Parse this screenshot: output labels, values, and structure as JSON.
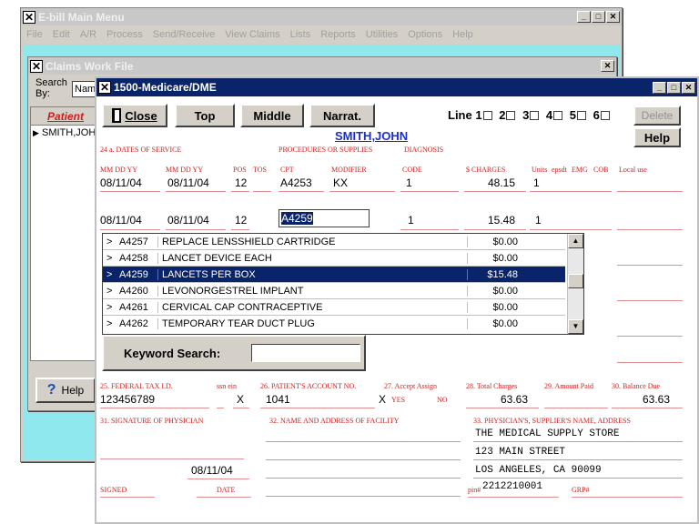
{
  "main_window": {
    "title": "E-bill Main Menu",
    "menu": [
      "File",
      "Edit",
      "A/R",
      "Process",
      "Send/Receive",
      "View Claims",
      "Lists",
      "Reports",
      "Utilities",
      "Options",
      "Help"
    ]
  },
  "claims_window": {
    "title": "Claims Work File",
    "search_label": "Search By:",
    "search_value": "Nam",
    "patient_header": "Patient",
    "patient_row": "SMITH,JOH",
    "help_button": "Help"
  },
  "form_window": {
    "title": "1500-Medicare/DME",
    "buttons": {
      "close": "Close",
      "top": "Top",
      "middle": "Middle",
      "narrat": "Narrat.",
      "delete": "Delete",
      "help": "Help"
    },
    "line_label": "Line 1",
    "line_numbers": [
      "2",
      "3",
      "4",
      "5",
      "6"
    ],
    "patient_name": "SMITH,JOHN",
    "labels": {
      "dates_of_service": "24 a. DATES OF SERVICE",
      "procedures": "PROCEDURES OR SUPPLIES",
      "diagnosis": "DIAGNOSIS",
      "from_date": "MM DD YY",
      "to_date": "MM DD YY",
      "pos": "POS",
      "tos": "TOS",
      "cpt": "CPT",
      "modifier": "MODIFIER",
      "code": "CODE",
      "charges": "$ CHARGES",
      "units": "Units",
      "epsdt": "epsdt",
      "emg": "EMG",
      "cob": "COB",
      "local_use": "Local use",
      "federal_tax": "25. FEDERAL TAX I.D.",
      "ssn_ein": "ssn ein",
      "patient_account": "26. PATIENT'S ACCOUNT NO.",
      "accept_assign": "27. Accept Assign",
      "yes": "YES",
      "no": "NO",
      "total_charges": "28. Total Charges",
      "amount_paid": "29. Amount Paid",
      "balance_due": "30. Balance Due",
      "signature": "31. SIGNATURE OF PHYSICIAN",
      "facility": "32. NAME AND ADDRESS OF FACILITY",
      "supplier": "33. PHYSICIAN'S, SUPPLIER'S NAME, ADDRESS",
      "signed": "SIGNED",
      "date": "DATE",
      "pin": "pin#",
      "grp": "GRP#"
    },
    "line1": {
      "from": "08/11/04",
      "to": "08/11/04",
      "pos": "12",
      "cpt": "A4253",
      "modifier": "KX",
      "code": "1",
      "charges": "48.15",
      "units": "1"
    },
    "line2": {
      "from": "08/11/04",
      "to": "08/11/04",
      "pos": "12",
      "cpt": "A4259",
      "code": "1",
      "charges": "15.48",
      "units": "1"
    },
    "dropdown": [
      {
        "code": "A4257",
        "desc": "REPLACE LENSSHIELD CARTRIDGE",
        "price": "$0.00"
      },
      {
        "code": "A4258",
        "desc": "LANCET DEVICE EACH",
        "price": "$0.00"
      },
      {
        "code": "A4259",
        "desc": "LANCETS PER BOX",
        "price": "$15.48"
      },
      {
        "code": "A4260",
        "desc": "LEVONORGESTREL IMPLANT",
        "price": "$0.00"
      },
      {
        "code": "A4261",
        "desc": "CERVICAL CAP CONTRACEPTIVE",
        "price": "$0.00"
      },
      {
        "code": "A4262",
        "desc": "TEMPORARY TEAR DUCT PLUG",
        "price": "$0.00"
      }
    ],
    "keyword_search_label": "Keyword Search:",
    "keyword_search_value": "",
    "tax_id": "123456789",
    "ein_mark": "X",
    "account_no": "1041",
    "yes_mark": "X",
    "total_charges": "63.63",
    "balance_due": "63.63",
    "sign_date": "08/11/04",
    "supplier_lines": [
      "THE MEDICAL SUPPLY STORE",
      "123 MAIN STREET",
      "LOS ANGELES, CA 90099"
    ],
    "pin": "2212210001"
  },
  "colors": {
    "active_title": "#0a246a",
    "form_label": "#cc2020",
    "selected_row": "#0a246a"
  }
}
